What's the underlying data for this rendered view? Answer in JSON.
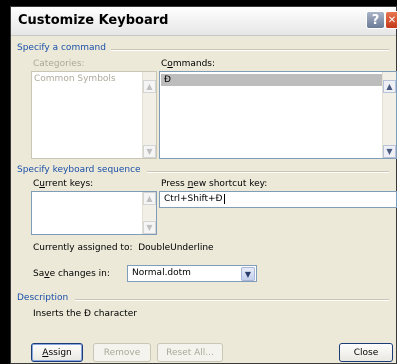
{
  "dialog": {
    "title": "Customize Keyboard",
    "help_glyph": "?",
    "close_glyph": "✕"
  },
  "specify_command": {
    "section_title": "Specify a command",
    "categories_label": "Categories:",
    "categories_items": [
      "Common Symbols"
    ],
    "commands_label_pre": "C",
    "commands_label_ul": "o",
    "commands_label_post": "mmands:",
    "commands_items": [
      "Đ"
    ]
  },
  "keyboard_sequence": {
    "section_title": "Specify keyboard sequence",
    "current_keys_label_pre": "C",
    "current_keys_label_ul": "u",
    "current_keys_label_post": "rrent keys:",
    "new_key_label_pre": "Press ",
    "new_key_label_ul": "n",
    "new_key_label_post": "ew shortcut key:",
    "new_key_value": "Ctrl+Shift+Đ",
    "assigned_label": "Currently assigned to:",
    "assigned_value": "DoubleUnderline"
  },
  "save_changes": {
    "label_pre": "Sa",
    "label_ul": "v",
    "label_post": "e changes in:",
    "value": "Normal.dotm"
  },
  "description": {
    "section_title": "Description",
    "text": "Inserts the Đ character"
  },
  "buttons": {
    "assign_ul": "A",
    "assign_post": "ssign",
    "remove": "Remove",
    "reset_all": "Reset All...",
    "close": "Close"
  }
}
